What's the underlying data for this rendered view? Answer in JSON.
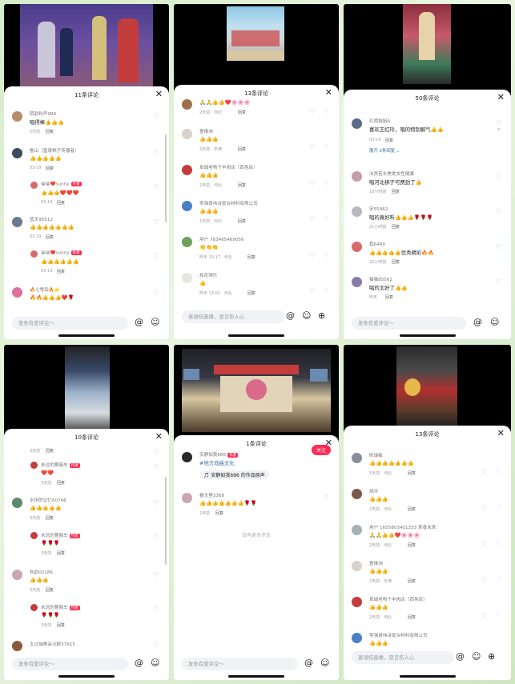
{
  "panels": [
    {
      "title": "11条评论",
      "input_placeholder": "发条有爱评论～",
      "comments": [
        {
          "name": "陌韵秋声999",
          "text": "唱得棒👍👍👍",
          "time": "2天前",
          "reply": "回复",
          "likes": ""
        },
        {
          "name": "鲁山（直隶梆子传播者）",
          "text": "👍👍👍👍👍",
          "time": "03-19",
          "reply": "回复",
          "likes": ""
        },
        {
          "name": "😀😀❤️sunny",
          "author": "作者",
          "text": "👍👍👍❤️❤️❤️",
          "time": "03-19",
          "reply": "回复",
          "sub": true
        },
        {
          "name": "蓝天95512",
          "text": "👍👍👍👍👍👍👍",
          "time": "03-19",
          "reply": "回复"
        },
        {
          "name": "😀😀❤️sunny",
          "author": "作者",
          "text": "👍👍👍👍👍👍",
          "time": "03-19",
          "reply": "回复",
          "sub": true
        },
        {
          "name": "🔥七零后🔥🌟",
          "text": "🔥🔥👍👍👍❤️🌹",
          "time": "",
          "reply": ""
        }
      ]
    },
    {
      "title": "13条评论",
      "input_placeholder": "善语结善缘，恶言伤人心",
      "comments": [
        {
          "name": "",
          "text": "🙏🙏👍👍❤️🌸🌸🌸",
          "time": "2天前 · 河北",
          "reply": "回复"
        },
        {
          "name": "童维洲",
          "text": "👍👍👍",
          "time": "2天前 · 天津",
          "reply": "回复"
        },
        {
          "name": "阜城老鸭千羊肉店（西苑店）",
          "text": "👍👍👍",
          "time": "2天前 · 河北",
          "reply": "回复"
        },
        {
          "name": "枣强县伟诗复合材料有限公司",
          "text": "👍👍👍",
          "time": "1天前 · 河北",
          "reply": "回复"
        },
        {
          "name": "用户 783465469056",
          "text": "👏👏👏",
          "time": "昨天 10:17 · 河北",
          "reply": "回复"
        },
        {
          "name": "和花琴乐",
          "text": "👍",
          "time": "昨天 13:01 · 河北",
          "reply": "回复"
        }
      ]
    },
    {
      "title": "50条评论",
      "input_placeholder": "发条有爱评论～",
      "expand_text": "展开 2条回复",
      "comments": [
        {
          "name": "红旗姐姐A",
          "text": "喜欢王红玲，唱的特别解气👍👍",
          "time": "03-19",
          "reply": "回复",
          "likes": "7"
        },
        {
          "name": "法然若水美爱女性健康",
          "text": "唱河北梆子可费劲了👍",
          "time": "16小时前",
          "reply": "回复"
        },
        {
          "name": "宋55462",
          "text": "唱的真好听👍👍👍🌹🌹🌹",
          "time": "21小时前",
          "reply": "回复"
        },
        {
          "name": "我6469",
          "text": "👍👍👍👍👍优秀精彩🔥🔥",
          "time": "22小时前",
          "reply": "回复"
        },
        {
          "name": "猫猫85562",
          "text": "唱的太好了👍👍",
          "time": "昨天",
          "reply": "回复"
        }
      ]
    },
    {
      "title": "10条评论",
      "input_placeholder": "发条有爱评论～",
      "comments": [
        {
          "name": "",
          "text": "",
          "time": "3天前",
          "reply": "回复"
        },
        {
          "name": "未远的蔷薇车",
          "author": "作者",
          "text": "❤️❤️",
          "time": "3天前",
          "reply": "回复",
          "sub": true
        },
        {
          "name": "永恒的记忆60746",
          "text": "👍👍👍👍👍",
          "time": "3天前",
          "reply": "回复"
        },
        {
          "name": "未远的蔷薇车",
          "author": "作者",
          "text": "🌹🌹🌹",
          "time": "3天前",
          "reply": "回复",
          "sub": true
        },
        {
          "name": "秋韵02186",
          "text": "👍👍👍",
          "time": "3天前",
          "reply": "回复"
        },
        {
          "name": "未远的蔷薇车",
          "author": "作者",
          "text": "🌹🌹🌹",
          "time": "3天前",
          "reply": "回复",
          "sub": true
        },
        {
          "name": "太过瑞美会沉醉37915",
          "text": "",
          "time": "",
          "reply": ""
        }
      ]
    },
    {
      "title": "1条评论",
      "input_placeholder": "发条有爱评论～",
      "follow_label": "关注",
      "author_name": "安静如我666",
      "author_tag": "作者",
      "author_text": "#地方戏曲文化",
      "link_text": "🎵 安静如我666 的作品原声",
      "comments": [
        {
          "name": "春天里3368",
          "text": "👍👍👍👍👍👍👍🌹🌹",
          "time": "2天前",
          "reply": "回复"
        }
      ],
      "no_more": "没有更多评论"
    },
    {
      "title": "13条评论",
      "input_placeholder": "善语结善缘，恶言伤人心",
      "comments": [
        {
          "name": "陈瑞敏",
          "text": "👍👍👍👍👍👍👍",
          "time": "1天前 · 河北",
          "reply": "回复"
        },
        {
          "name": "胡平",
          "text": "👍👍👍",
          "time": "2天前 · 河北",
          "reply": "回复"
        },
        {
          "name": "用户 1655803401333 茶香未来",
          "text": "🙏🙏👍👍❤️🌸🌸🌸",
          "time": "2天前 · 河北",
          "reply": "回复"
        },
        {
          "name": "童维洲",
          "text": "👍👍👍",
          "time": "2天前 · 天津",
          "reply": "回复"
        },
        {
          "name": "阜城老鸭千羊肉店（西苑店）",
          "text": "👍👍👍",
          "time": "2天前 · 河北",
          "reply": "回复"
        },
        {
          "name": "枣强县伟诗复合材料有限公司",
          "text": "👍👍👍",
          "time": "",
          "reply": ""
        }
      ]
    }
  ]
}
